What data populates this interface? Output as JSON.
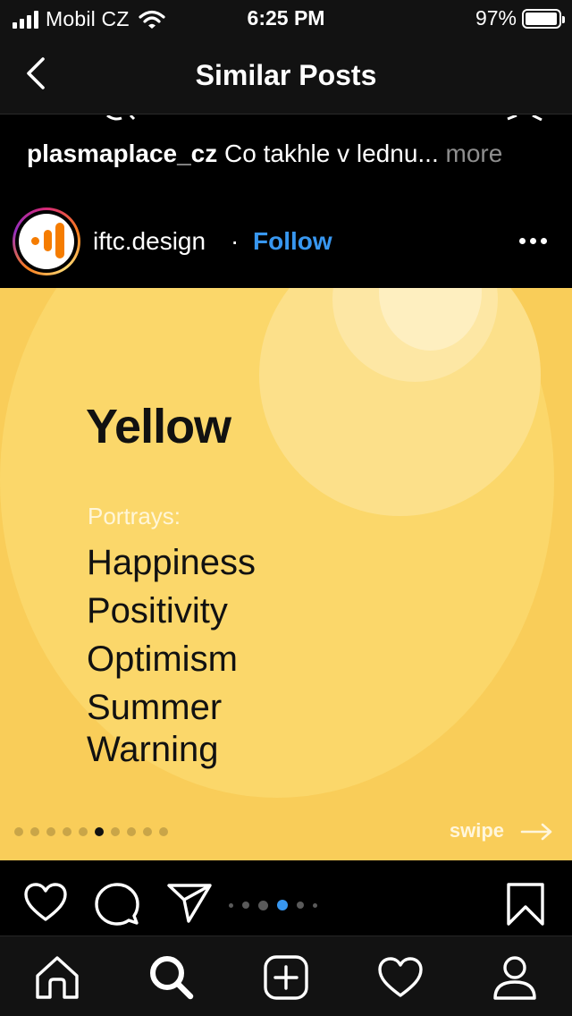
{
  "status_bar": {
    "carrier": "Mobil CZ",
    "time": "6:25 PM",
    "battery_percent": "97%",
    "battery_level": 0.97,
    "icons": [
      "signal-icon",
      "wifi-icon",
      "battery-icon"
    ]
  },
  "header": {
    "title": "Similar Posts",
    "back_icon": "chevron-left-icon"
  },
  "previous_post": {
    "username": "plasmaplace_cz",
    "caption": "Co takhle v lednu...",
    "more_label": "more"
  },
  "post": {
    "username": "iftc.design",
    "separator": "·",
    "follow_label": "Follow",
    "image": {
      "title": "Yellow",
      "subtitle": "Portrays:",
      "items": [
        "Happiness",
        "Positivity",
        "Optimism",
        "Summer",
        "Warning"
      ],
      "swipe_label": "swipe",
      "slide_count": 10,
      "active_slide": 6
    },
    "carousel_indicator": {
      "count": 6,
      "active_index": 4
    }
  },
  "actions": [
    "heart-icon",
    "comment-icon",
    "share-icon",
    "bookmark-icon"
  ],
  "tab_bar": [
    "home-icon",
    "search-icon",
    "add-post-icon",
    "activity-heart-icon",
    "profile-icon"
  ],
  "colors": {
    "background": "#000000",
    "bar_background": "#121212",
    "link_blue": "#3897f0",
    "post_yellow": "#f9cd59",
    "muted_text": "#8e8e8e"
  }
}
